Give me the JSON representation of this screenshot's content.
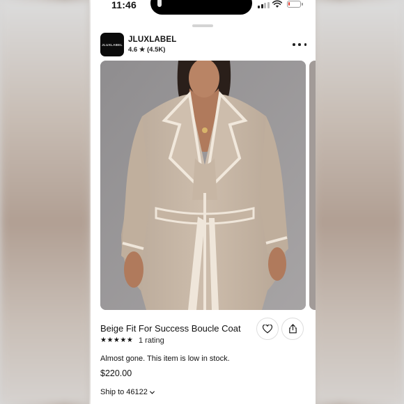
{
  "status_bar": {
    "time": "11:46",
    "battery_level": 0.15,
    "signal_bars_active": 2,
    "signal_bars_total": 4,
    "icons": [
      "wifi-icon",
      "battery-icon",
      "signal-icon"
    ]
  },
  "brand": {
    "logo_text": "JLUXLABEL",
    "name": "JLUXLABEL",
    "rating_text": "4.6 ★ (4.5K)"
  },
  "product": {
    "title": "Beige Fit For Success Boucle Coat",
    "stars_text": "★★★★★",
    "rating_count_label": "1 rating",
    "stock_note": "Almost gone. This item is low in stock.",
    "price": "$220.00",
    "ship_label": "Ship to 46122"
  },
  "colors": {
    "coat": "#c9b9a8",
    "coat_trim": "#efe6da",
    "backdrop": "#9a9899",
    "battery_low": "#e23b2e"
  }
}
